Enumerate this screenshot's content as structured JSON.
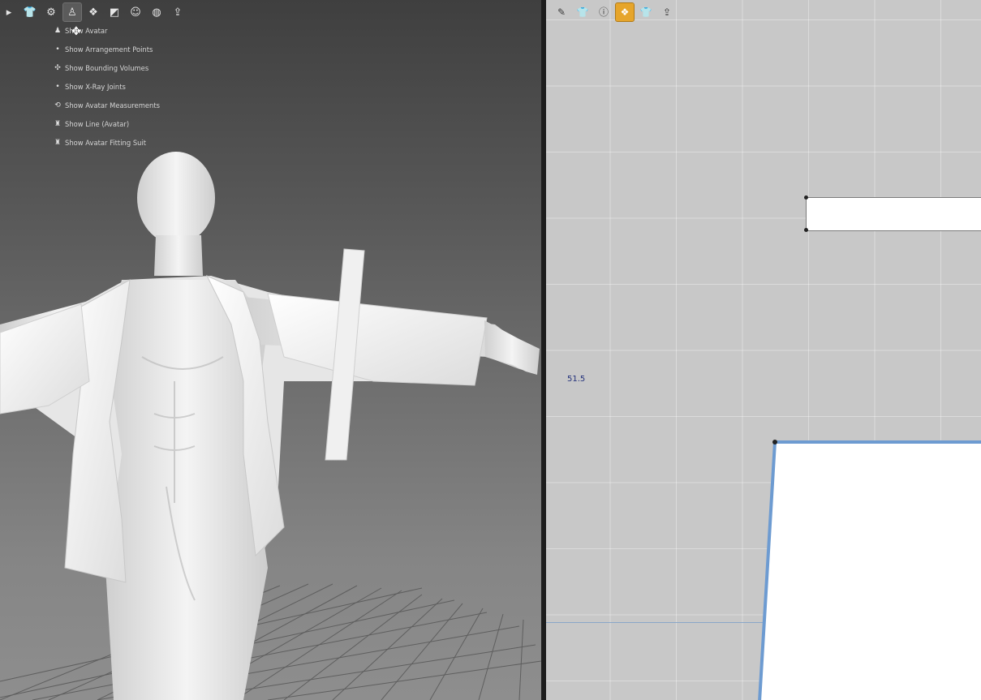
{
  "viewport3d": {
    "toolbar": [
      {
        "name": "hanger-icon",
        "glyph": "▸"
      },
      {
        "name": "garment-icon",
        "glyph": "👕"
      },
      {
        "name": "gears-icon",
        "glyph": "⚙"
      },
      {
        "name": "avatar-icon",
        "glyph": "♙"
      },
      {
        "name": "texture-icon",
        "glyph": "❖"
      },
      {
        "name": "surface-icon",
        "glyph": "◩"
      },
      {
        "name": "skin-icon",
        "glyph": "☺"
      },
      {
        "name": "globe-icon",
        "glyph": "◍"
      },
      {
        "name": "export-icon",
        "glyph": "⇪"
      }
    ],
    "avatar_menu": [
      {
        "name": "show-avatar",
        "icon": "♟",
        "label": "Show Avatar"
      },
      {
        "name": "show-arrangement-points",
        "icon": "•",
        "label": "Show Arrangement Points"
      },
      {
        "name": "show-bounding-volumes",
        "icon": "✣",
        "label": "Show Bounding Volumes"
      },
      {
        "name": "show-xray-joints",
        "icon": "•",
        "label": "Show X-Ray Joints"
      },
      {
        "name": "show-avatar-measurements",
        "icon": "⟲",
        "label": "Show Avatar Measurements"
      },
      {
        "name": "show-line-avatar",
        "icon": "♜",
        "label": "Show Line (Avatar)"
      },
      {
        "name": "show-avatar-fitting-suit",
        "icon": "♜",
        "label": "Show Avatar Fitting Suit"
      }
    ]
  },
  "pattern2d": {
    "toolbar": [
      {
        "name": "brush-icon",
        "glyph": "✎"
      },
      {
        "name": "garment-2d-icon",
        "glyph": "👕"
      },
      {
        "name": "info-icon",
        "glyph": "ⓘ"
      },
      {
        "name": "texture-2d-icon",
        "glyph": "❖"
      },
      {
        "name": "shirt-gray-icon",
        "glyph": "👕"
      },
      {
        "name": "export-2d-icon",
        "glyph": "⇪"
      }
    ],
    "measurement": "51.5"
  },
  "colors": {
    "accent": "#e6a52b",
    "selection_outline": "#6d9bd1"
  }
}
